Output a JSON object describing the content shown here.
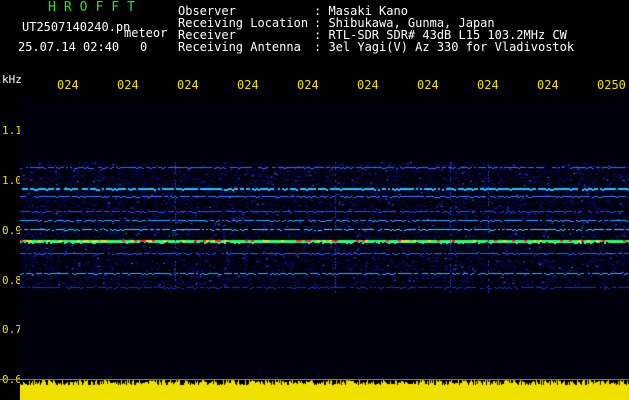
{
  "header": {
    "brand": "HROFFT",
    "file_name": "UT2507140240.pn",
    "meteor_label": "meteor",
    "timestamp": "25.07.14 02:40",
    "counter": "0",
    "info_rows": [
      {
        "label": "Observer",
        "value": ": Masaki Kano"
      },
      {
        "label": "Receiving Location",
        "value": ": Shibukawa, Gunma, Japan"
      },
      {
        "label": "Receiver",
        "value": ": RTL-SDR SDR# 43dB L15 103.2MHz CW"
      },
      {
        "label": "Receiving Antenna",
        "value": ": 3el Yagi(V) Az 330 for Vladivostok"
      }
    ]
  },
  "axis": {
    "unit": "kHz",
    "time_ticks": [
      "024",
      "024",
      "024",
      "024",
      "024",
      "024",
      "024",
      "024",
      "024",
      "0250"
    ],
    "freq_ticks": [
      "1.1",
      "1.0",
      "0.9",
      "0.8",
      "0.7",
      "0.6"
    ]
  },
  "colors": {
    "brand": "#22e622",
    "ticks": "#f0e000",
    "text": "#ffffff",
    "signal_bar": "#f0e000"
  }
}
